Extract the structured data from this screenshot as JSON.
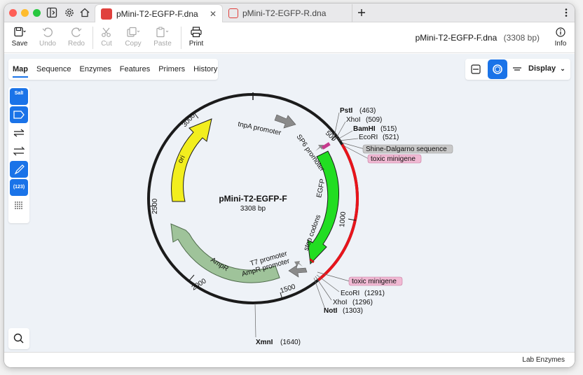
{
  "tabs": [
    {
      "label": "pMini-T2-EGFP-F.dna",
      "active": true
    },
    {
      "label": "pMini-T2-EGFP-R.dna",
      "active": false
    }
  ],
  "toolbar": {
    "save": "Save",
    "undo": "Undo",
    "redo": "Redo",
    "cut": "Cut",
    "copy": "Copy",
    "paste": "Paste",
    "print": "Print",
    "info": "Info"
  },
  "document": {
    "title": "pMini-T2-EGFP-F.dna",
    "length": "(3308 bp)"
  },
  "view_tabs": [
    "Map",
    "Sequence",
    "Enzymes",
    "Features",
    "Primers",
    "History"
  ],
  "display_label": "Display",
  "side_tools": {
    "sal": "SalI",
    "numbers": "(123)"
  },
  "map": {
    "name": "pMini-T2-EGFP-F",
    "length": "3308 bp",
    "ticks": [
      "500",
      "1000",
      "1500",
      "2000",
      "2500",
      "3000"
    ],
    "features": {
      "tnpA": "tnpA promoter",
      "sp6": "SP6 promoter",
      "egfp": "EGFP",
      "stop": "stop codons",
      "t7": "T7 promoter",
      "ampr_promoter": "AmpR promoter",
      "ampr": "AmpR",
      "ori": "ori"
    },
    "sites_top": [
      {
        "name": "PstI",
        "pos": "(463)",
        "bold": true
      },
      {
        "name": "XhoI",
        "pos": "(509)",
        "bold": false
      },
      {
        "name": "BamHI",
        "pos": "(515)",
        "bold": true
      },
      {
        "name": "EcoRI",
        "pos": "(521)",
        "bold": false
      }
    ],
    "sites_bottom": [
      {
        "name": "EcoRI",
        "pos": "(1291)",
        "bold": false
      },
      {
        "name": "XhoI",
        "pos": "(1296)",
        "bold": false
      },
      {
        "name": "NotI",
        "pos": "(1303)",
        "bold": true
      }
    ],
    "site_xmn": {
      "name": "XmnI",
      "pos": "(1640)"
    },
    "boxes": {
      "shine": "Shine-Dalgarno sequence",
      "toxic_top": "toxic minigene",
      "toxic_bottom": "toxic minigene"
    },
    "colors": {
      "egfp": "#22dd22",
      "ori": "#f2ee1e",
      "ampr": "#9fc39a",
      "highlight": "#e8141b",
      "promoter": "#8a8a8a"
    }
  },
  "status": "Lab Enzymes"
}
